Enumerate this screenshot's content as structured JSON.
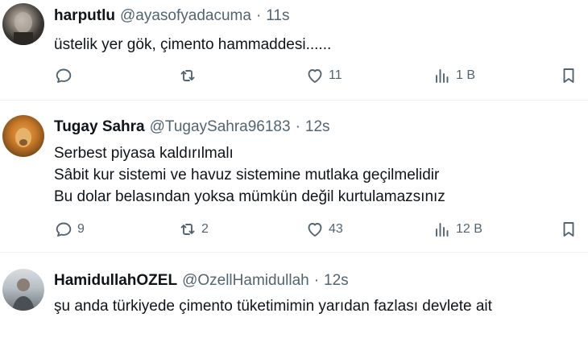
{
  "tweets": [
    {
      "name": "harputlu",
      "handle": "@ayasofyadacuma",
      "sep": "·",
      "time": "11s",
      "lines": [
        "üstelik yer gök, çimento hammaddesi......"
      ],
      "reply_count": "",
      "retweet_count": "",
      "like_count": "11",
      "view_count": "1 B"
    },
    {
      "name": "Tugay Sahra",
      "handle": "@TugaySahra96183",
      "sep": "·",
      "time": "12s",
      "lines": [
        "Serbest piyasa kaldırılmalı",
        "Sâbit kur sistemi ve havuz sistemine mutlaka geçilmelidir",
        "Bu dolar belasından yoksa mümkün değil kurtulamazsınız"
      ],
      "reply_count": "9",
      "retweet_count": "2",
      "like_count": "43",
      "view_count": "12 B"
    },
    {
      "name": "HamidullahOZEL",
      "handle": "@OzellHamidullah",
      "sep": "·",
      "time": "12s",
      "lines": [
        "şu anda türkiyede çimento tüketimimin yarıdan fazlası devlete ait"
      ]
    }
  ],
  "colors": {
    "text": "#0f1419",
    "secondary": "#536471",
    "divider": "#eff3f4"
  },
  "icons": [
    "reply-icon",
    "retweet-icon",
    "like-icon",
    "views-icon",
    "bookmark-icon"
  ]
}
